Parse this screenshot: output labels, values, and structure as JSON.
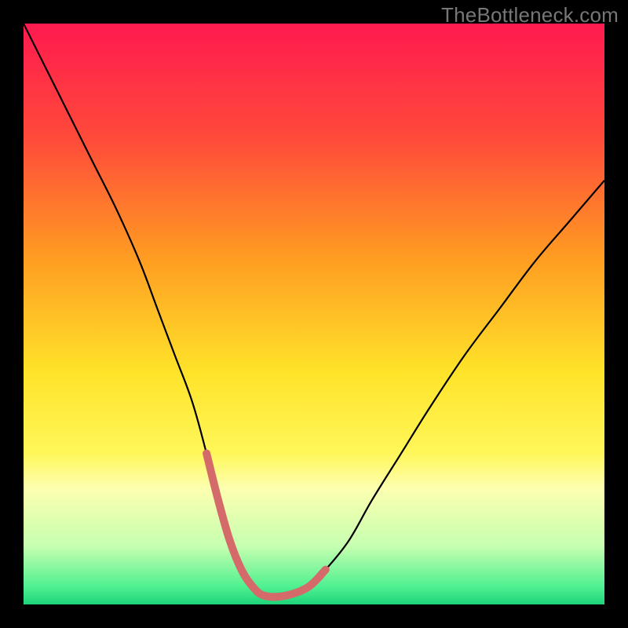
{
  "watermark": "TheBottleneck.com",
  "chart_data": {
    "type": "line",
    "title": "",
    "xlabel": "",
    "ylabel": "",
    "xlim": [
      0,
      100
    ],
    "ylim": [
      0,
      100
    ],
    "grid": false,
    "legend": false,
    "background_gradient": {
      "stops": [
        {
          "offset": 0.0,
          "color": "#ff1a4f"
        },
        {
          "offset": 0.2,
          "color": "#ff4b3a"
        },
        {
          "offset": 0.4,
          "color": "#ff9b22"
        },
        {
          "offset": 0.6,
          "color": "#ffe329"
        },
        {
          "offset": 0.74,
          "color": "#fff75a"
        },
        {
          "offset": 0.8,
          "color": "#fdffb0"
        },
        {
          "offset": 0.9,
          "color": "#c6ffb0"
        },
        {
          "offset": 0.97,
          "color": "#4ef090"
        },
        {
          "offset": 1.0,
          "color": "#1fd47a"
        }
      ]
    },
    "series": [
      {
        "name": "curve",
        "stroke": "#000000",
        "stroke_width": 2.2,
        "x": [
          0,
          4,
          8,
          12,
          16,
          20,
          23,
          26,
          29,
          31.5,
          33.5,
          35.5,
          37.5,
          39.5,
          41.5,
          45,
          49,
          52,
          56,
          60,
          65,
          70,
          76,
          82,
          88,
          94,
          100
        ],
        "y": [
          100,
          92,
          84,
          76,
          68,
          59,
          51,
          43,
          35,
          26,
          18,
          11,
          6,
          3,
          1.5,
          1.5,
          3,
          6,
          11,
          18,
          26,
          34,
          43,
          51,
          59,
          66,
          73
        ]
      },
      {
        "name": "highlight",
        "stroke": "#d46a6a",
        "stroke_width": 10,
        "linecap": "round",
        "x": [
          31.5,
          33.5,
          35.5,
          37.5,
          39.5,
          41.5,
          45,
          49,
          52
        ],
        "y": [
          26,
          18,
          11,
          6,
          3,
          1.5,
          1.5,
          3,
          6
        ]
      }
    ]
  }
}
